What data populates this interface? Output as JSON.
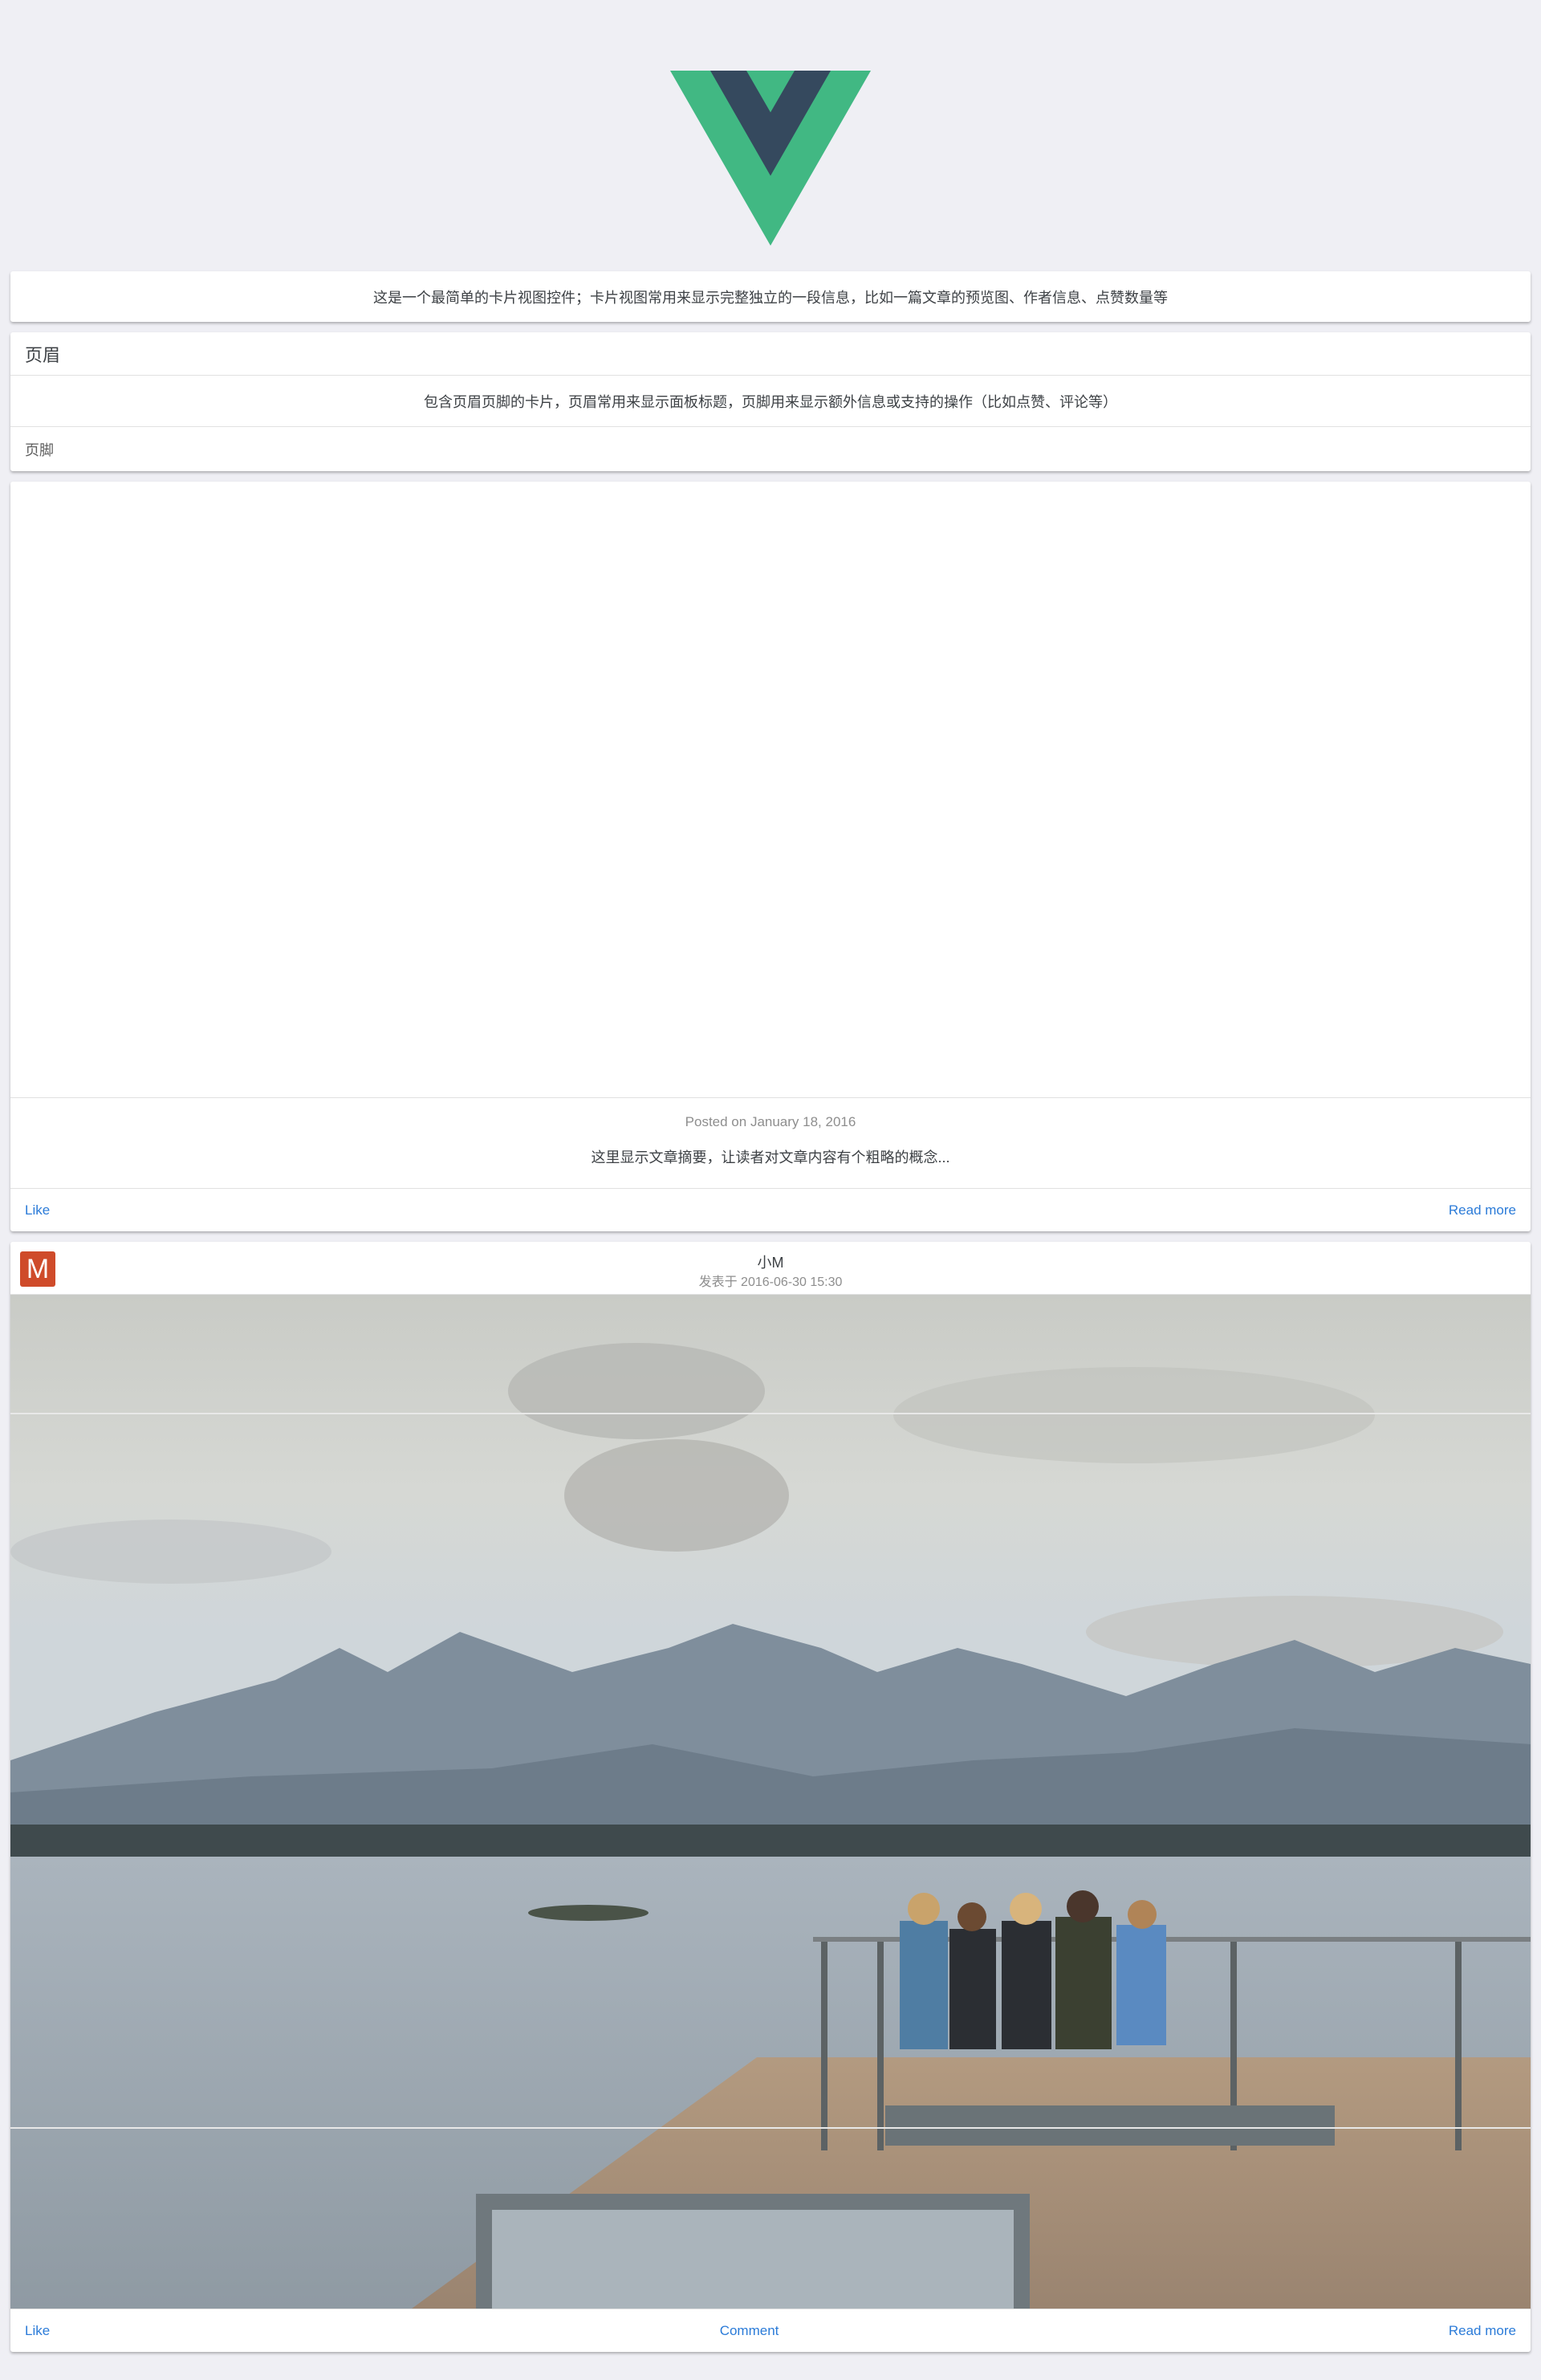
{
  "logo": {
    "name": "Vue logo",
    "colors": {
      "outer": "#41b883",
      "inner": "#35495e"
    }
  },
  "card_simple": {
    "content": "这是一个最简单的卡片视图控件；卡片视图常用来显示完整独立的一段信息，比如一篇文章的预览图、作者信息、点赞数量等"
  },
  "card_header_footer": {
    "header": "页眉",
    "content": "包含页眉页脚的卡片，页眉常用来显示面板标题，页脚用来显示额外信息或支持的操作（比如点赞、评论等）",
    "footer": "页脚"
  },
  "card_post": {
    "date": "Posted on January 18, 2016",
    "summary": "这里显示文章摘要，让读者对文章内容有个粗略的概念...",
    "like": "Like",
    "read_more": "Read more"
  },
  "card_author": {
    "avatar_letter": "M",
    "author": "小M",
    "posted": "发表于 2016-06-30 15:30",
    "like": "Like",
    "comment": "Comment",
    "read_more": "Read more",
    "image": "lake-mountains-dock-photo"
  },
  "colors": {
    "accent": "#2b7bd8",
    "background": "#efeff4",
    "avatar": "#cf4b2a"
  }
}
